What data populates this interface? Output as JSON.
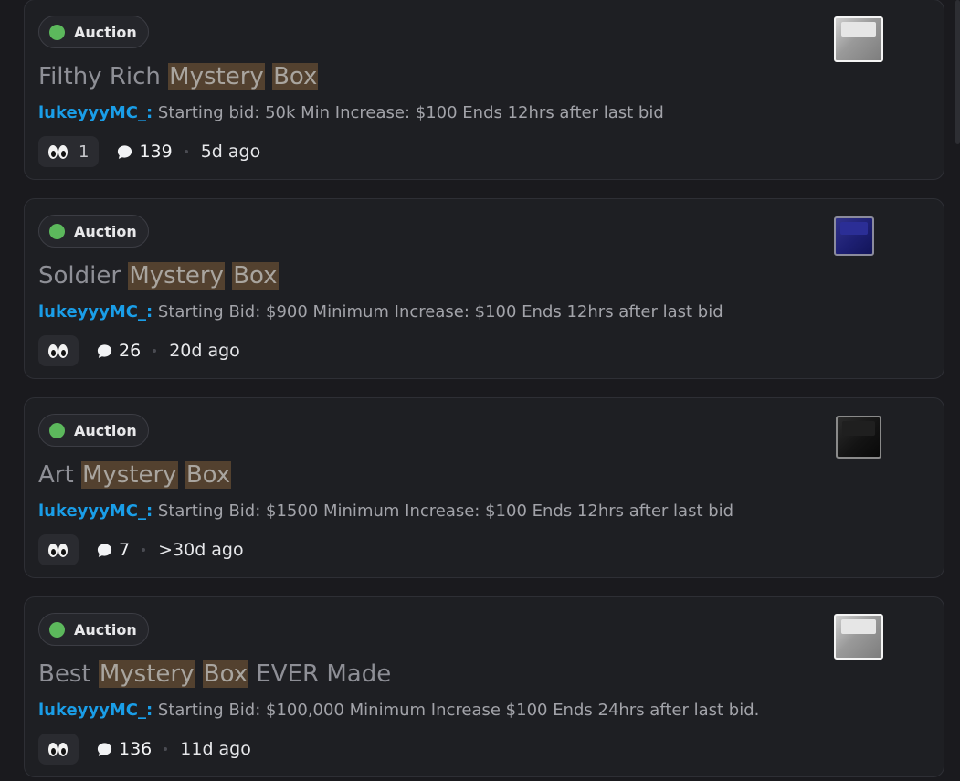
{
  "posts": [
    {
      "tag": "Auction",
      "title_before": "Filthy Rich ",
      "title_hl1": "Mystery",
      "title_hl2": "Box",
      "title_after": "",
      "author": "lukeyyyMC_:",
      "snippet": " Starting bid: 50k Min Increase: $100 Ends 12hrs after last bid",
      "reaction_count": "1",
      "reply_count": "139",
      "time_ago": "5d ago",
      "thumbnail": "white-cube"
    },
    {
      "tag": "Auction",
      "title_before": "Soldier ",
      "title_hl1": "Mystery",
      "title_hl2": "Box",
      "title_after": "",
      "author": "lukeyyyMC_:",
      "snippet": " Starting Bid: $900 Minimum Increase: $100 Ends 12hrs after last bid",
      "reaction_count": "",
      "reply_count": "26",
      "time_ago": "20d ago",
      "thumbnail": "blue-cube"
    },
    {
      "tag": "Auction",
      "title_before": "Art ",
      "title_hl1": "Mystery",
      "title_hl2": "Box",
      "title_after": "",
      "author": "lukeyyyMC_:",
      "snippet": " Starting Bid: $1500 Minimum Increase: $100 Ends 12hrs after last bid",
      "reaction_count": "",
      "reply_count": "7",
      "time_ago": ">30d ago",
      "thumbnail": "black-cube"
    },
    {
      "tag": "Auction",
      "title_before": "Best ",
      "title_hl1": "Mystery",
      "title_hl2": "Box",
      "title_after": " EVER Made",
      "author": "lukeyyyMC_:",
      "snippet": " Starting Bid: $100,000 Minimum Increase $100 Ends 24hrs after last bid.",
      "reaction_count": "",
      "reply_count": "136",
      "time_ago": "11d ago",
      "thumbnail": "white-cube"
    }
  ],
  "colors": {
    "background": "#1a1a1e",
    "card": "#1e1f23",
    "tag_dot": "#5cb85c",
    "author": "#1a9ee8",
    "highlight": "#53412f"
  },
  "icons": {
    "reaction": "eyes-emoji-icon",
    "reply": "speech-bubble-icon"
  }
}
